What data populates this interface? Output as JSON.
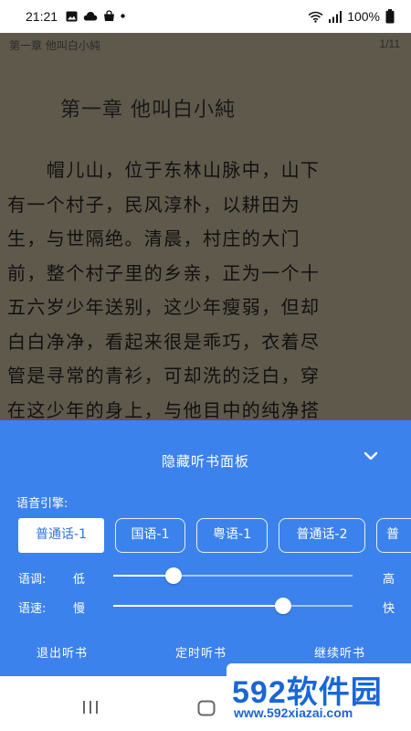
{
  "status_bar": {
    "time": "21:21",
    "battery": "100%"
  },
  "reader": {
    "header_chapter": "第一章 他叫白小純",
    "page_indicator": "1/11",
    "chapter_title": "第一章 他叫白小純",
    "lines": [
      "　　帽儿山，位于东林山脉中，山下",
      "有一个村子，民风淳朴，以耕田为",
      "生，与世隔绝。清晨，村庄的大门",
      "前，整个村子里的乡亲，正为一个十",
      "五六岁少年送别，这少年瘦弱，但却",
      "白白净净，看起来很是乖巧，衣着尽",
      "管是寻常的青衫，可却洗的泛白，穿",
      "在这少年的身上，与他目中的纯净搭"
    ]
  },
  "panel": {
    "title": "隐藏听书面板",
    "engine_label": "语音引擎:",
    "engines": [
      "普通话-1",
      "国语-1",
      "粤语-1",
      "普通话-2",
      "普"
    ],
    "selected_engine": "普通话-1",
    "tone": {
      "label": "语调:",
      "low": "低",
      "high": "高",
      "value": 0.25
    },
    "speed": {
      "label": "语速:",
      "low": "慢",
      "high": "快",
      "value": 0.71
    },
    "actions": {
      "exit": "退出听书",
      "timer": "定时听书",
      "continue": "继续听书"
    }
  },
  "watermark": {
    "logo": "592软件园",
    "site": "www.592xiazai.com"
  }
}
